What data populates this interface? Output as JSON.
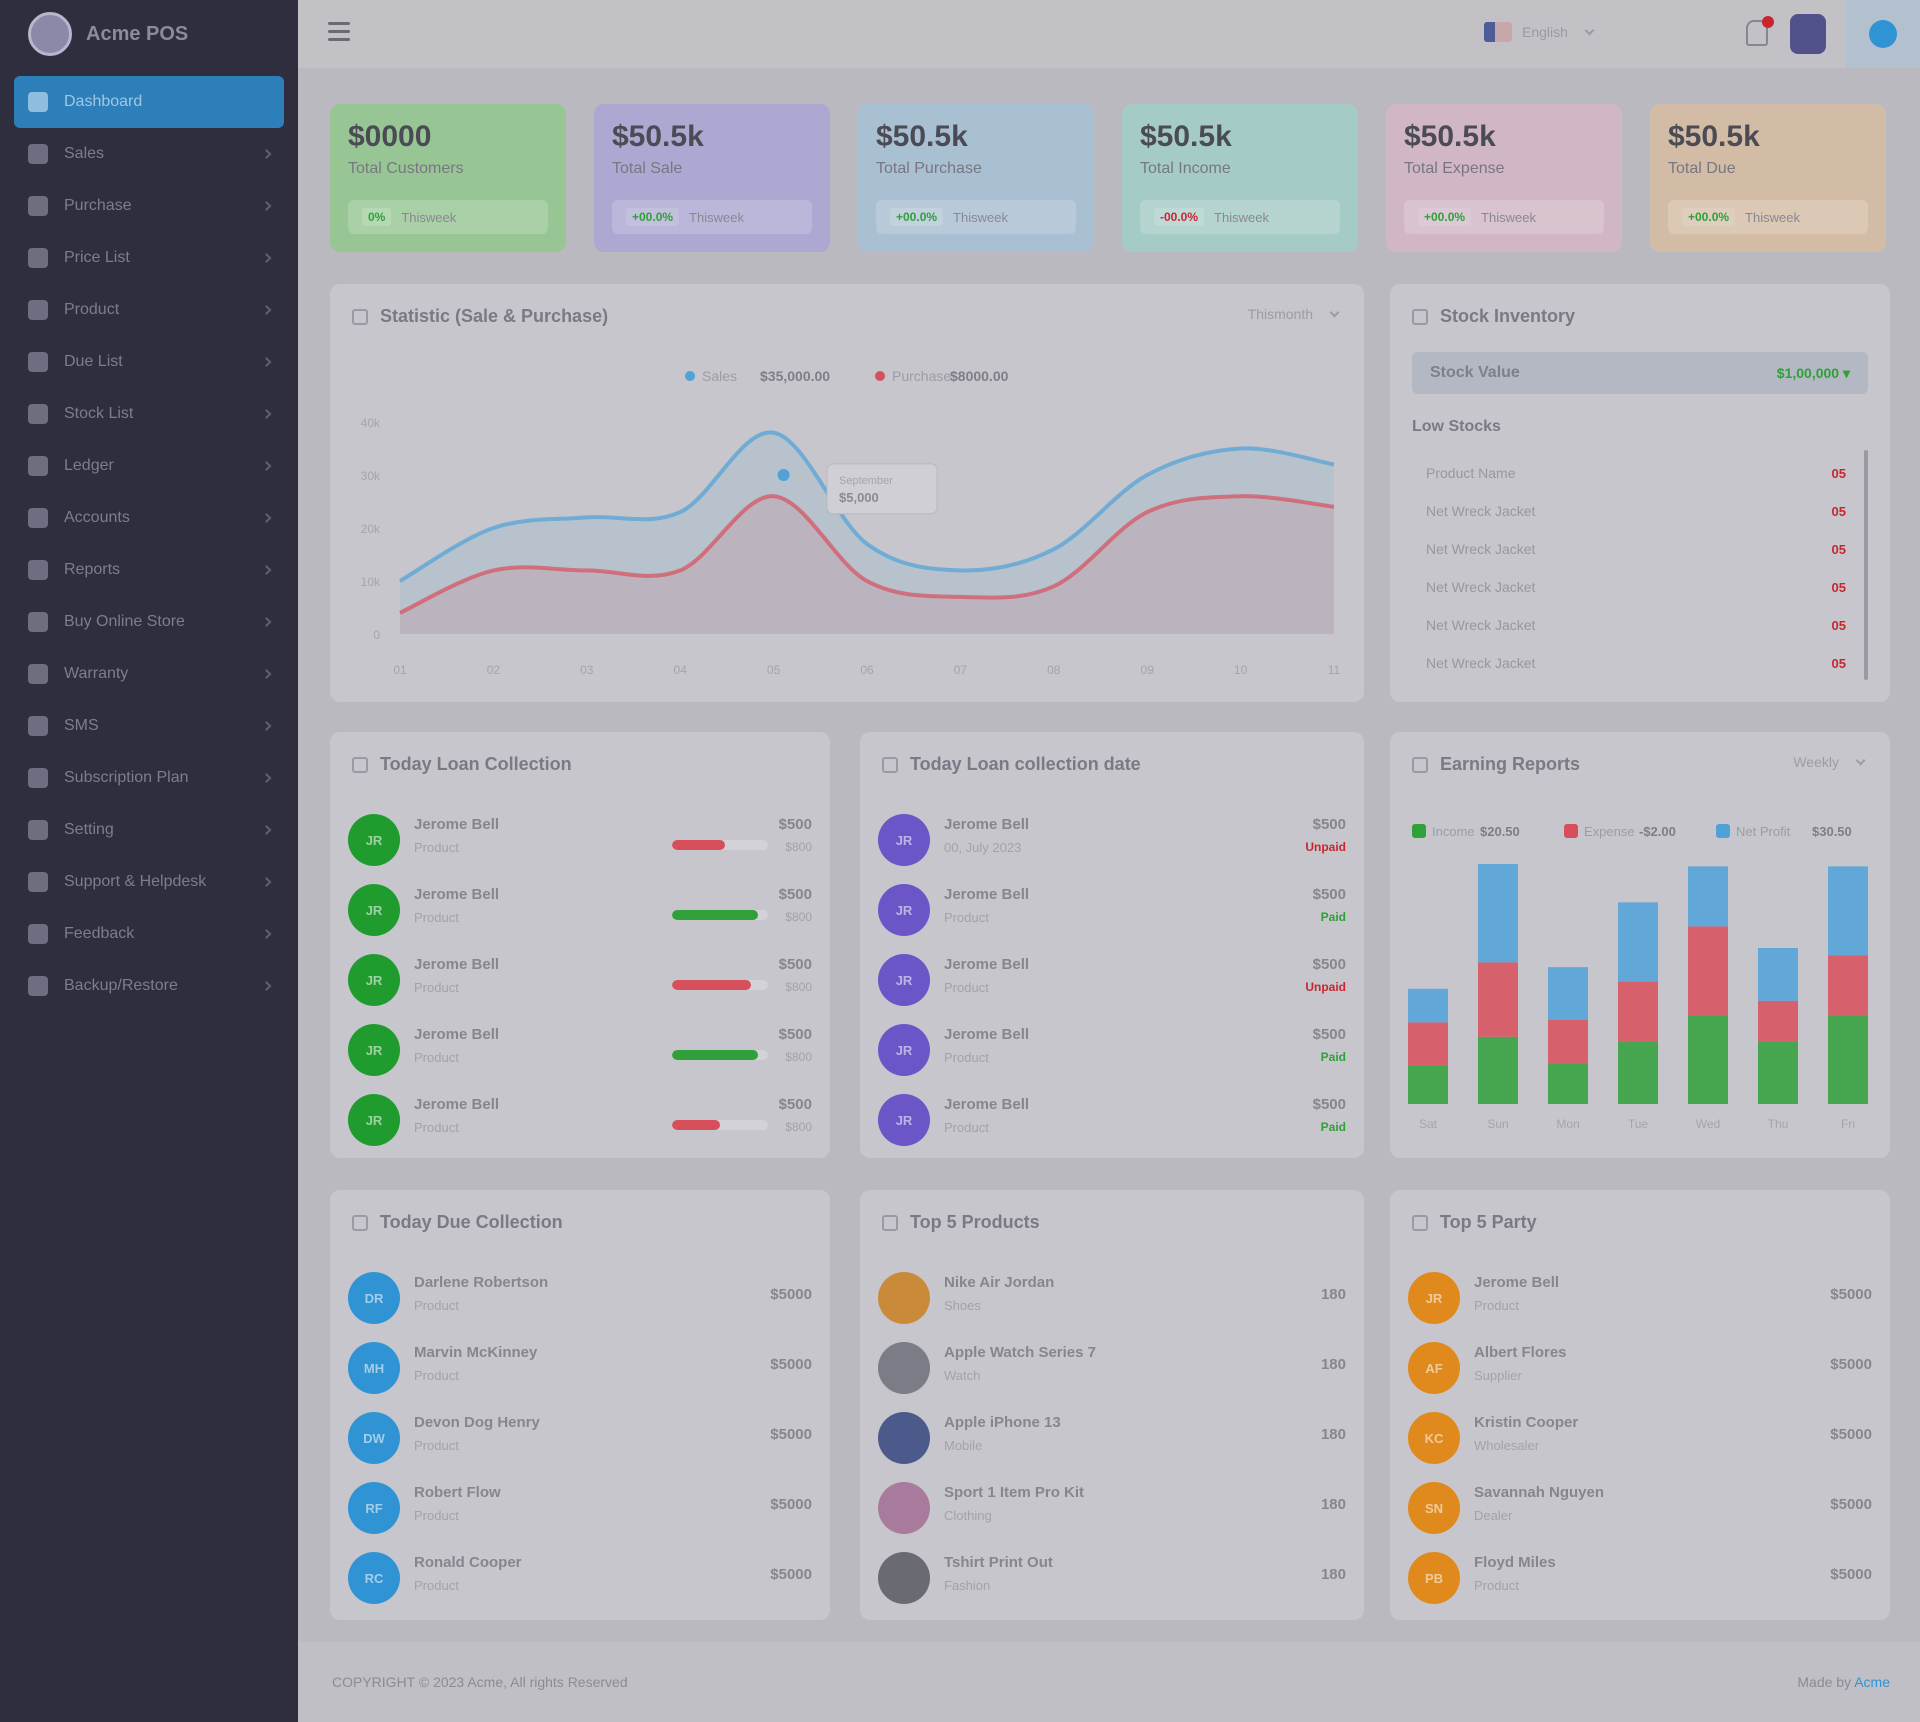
{
  "brand": {
    "name": "Acme POS"
  },
  "sidebar": {
    "items": [
      {
        "label": "Dashboard",
        "active": true
      },
      {
        "label": "Sales"
      },
      {
        "label": "Purchase"
      },
      {
        "label": "Price List"
      },
      {
        "label": "Product"
      },
      {
        "label": "Due List"
      },
      {
        "label": "Stock List"
      },
      {
        "label": "Ledger"
      },
      {
        "label": "Accounts"
      },
      {
        "label": "Reports"
      },
      {
        "label": "Buy Online Store"
      },
      {
        "label": "Warranty"
      },
      {
        "label": "SMS"
      },
      {
        "label": "Subscription Plan"
      },
      {
        "label": "Setting"
      },
      {
        "label": "Support & Helpdesk"
      },
      {
        "label": "Feedback"
      },
      {
        "label": "Backup/Restore"
      }
    ]
  },
  "header": {
    "language": "English"
  },
  "stats": [
    {
      "value": "$0000",
      "label": "Total Customers",
      "chip": "0%",
      "foot": "Thisweek",
      "bg": "#97c694",
      "chipColor": "#2fa03a",
      "chipBg": "#b6d9b4"
    },
    {
      "value": "$50.5k",
      "label": "Total Sale",
      "chip": "+00.0%",
      "foot": "Thisweek",
      "bg": "#ada8d2",
      "chipColor": "#2fa03a",
      "chipBg": "#c3c0de"
    },
    {
      "value": "$50.5k",
      "label": "Total Purchase",
      "chip": "+00.0%",
      "foot": "Thisweek",
      "bg": "#a9bfd2",
      "chipColor": "#2fa03a",
      "chipBg": "#c1d1de"
    },
    {
      "value": "$50.5k",
      "label": "Total Income",
      "chip": "-00.0%",
      "foot": "Thisweek",
      "bg": "#a5cbc6",
      "chipColor": "#c8262f",
      "chipBg": "#bfdad6"
    },
    {
      "value": "$50.5k",
      "label": "Total Expense",
      "chip": "+00.0%",
      "foot": "Thisweek",
      "bg": "#d1b6c5",
      "chipColor": "#2fa03a",
      "chipBg": "#ddc9d5"
    },
    {
      "value": "$50.5k",
      "label": "Total Due",
      "chip": "+00.0%",
      "foot": "Thisweek",
      "bg": "#d3bca5",
      "chipColor": "#2fa03a",
      "chipBg": "#decebe"
    }
  ],
  "statistic": {
    "title": "Statistic (Sale & Purchase)",
    "select": "Thismonth",
    "chart_data": {
      "type": "area",
      "x": [
        "01",
        "02",
        "03",
        "04",
        "05",
        "06",
        "07",
        "08",
        "09",
        "10",
        "11"
      ],
      "yticks": [
        "0",
        "10k",
        "20k",
        "30k",
        "40k"
      ],
      "ylim": [
        0,
        40
      ],
      "series": [
        {
          "name": "Sales",
          "total": "$35,000.00",
          "color": "#4fa1d8",
          "values": [
            10,
            20,
            22,
            23,
            38,
            17,
            12,
            16,
            30,
            35,
            32
          ]
        },
        {
          "name": "Purchase",
          "total": "$8000.00",
          "color": "#d84f5c",
          "values": [
            4,
            12,
            12,
            12,
            26,
            10,
            7,
            9,
            23,
            26,
            24
          ]
        }
      ],
      "tooltip": {
        "label": "September",
        "value": "$5,000"
      }
    }
  },
  "stock": {
    "title": "Stock Inventory",
    "status_label": "Stock Value",
    "status_value": "$1,00,000 ▾",
    "low_title": "Low Stocks",
    "items": [
      {
        "name": "Product Name",
        "qty": "05"
      },
      {
        "name": "Net Wreck Jacket",
        "qty": "05"
      },
      {
        "name": "Net Wreck Jacket",
        "qty": "05"
      },
      {
        "name": "Net Wreck Jacket",
        "qty": "05"
      },
      {
        "name": "Net Wreck Jacket",
        "qty": "05"
      },
      {
        "name": "Net Wreck Jacket",
        "qty": "05"
      }
    ]
  },
  "loan": {
    "title": "Today Loan Collection",
    "rows": [
      {
        "initials": "JR",
        "name": "Jerome Bell",
        "sub": "Product",
        "amount": "$500",
        "total": "$800",
        "pct": 55,
        "color": "#d84f5c"
      },
      {
        "initials": "JR",
        "name": "Jerome Bell",
        "sub": "Product",
        "amount": "$500",
        "total": "$800",
        "pct": 90,
        "color": "#2fa03a"
      },
      {
        "initials": "JR",
        "name": "Jerome Bell",
        "sub": "Product",
        "amount": "$500",
        "total": "$800",
        "pct": 82,
        "color": "#d84f5c"
      },
      {
        "initials": "JR",
        "name": "Jerome Bell",
        "sub": "Product",
        "amount": "$500",
        "total": "$800",
        "pct": 90,
        "color": "#2fa03a"
      },
      {
        "initials": "JR",
        "name": "Jerome Bell",
        "sub": "Product",
        "amount": "$500",
        "total": "$800",
        "pct": 50,
        "color": "#d84f5c"
      }
    ]
  },
  "loan_date": {
    "title": "Today Loan collection date",
    "rows": [
      {
        "initials": "JR",
        "name": "Jerome Bell",
        "sub": "00, July 2023",
        "amount": "$500",
        "status": "Unpaid",
        "color": "#c8262f"
      },
      {
        "initials": "JR",
        "name": "Jerome Bell",
        "sub": "Product",
        "amount": "$500",
        "status": "Paid",
        "color": "#2fa03a"
      },
      {
        "initials": "JR",
        "name": "Jerome Bell",
        "sub": "Product",
        "amount": "$500",
        "status": "Unpaid",
        "color": "#c8262f"
      },
      {
        "initials": "JR",
        "name": "Jerome Bell",
        "sub": "Product",
        "amount": "$500",
        "status": "Paid",
        "color": "#2fa03a"
      },
      {
        "initials": "JR",
        "name": "Jerome Bell",
        "sub": "Product",
        "amount": "$500",
        "status": "Paid",
        "color": "#2fa03a"
      }
    ]
  },
  "earning": {
    "title": "Earning Reports",
    "select": "Weekly",
    "chart_data": {
      "type": "bar",
      "categories": [
        "Sat",
        "Sun",
        "Mon",
        "Tue",
        "Wed",
        "Thu",
        "Fri"
      ],
      "ylim": [
        0,
        100
      ],
      "series": [
        {
          "name": "Income",
          "total": "$20.50",
          "color": "#2fa03a",
          "values": [
            16,
            28,
            17,
            26,
            37,
            26,
            37
          ]
        },
        {
          "name": "Expense",
          "total": "-$2.00",
          "color": "#d84f5c",
          "values": [
            18,
            31,
            18,
            25,
            37,
            17,
            25
          ]
        },
        {
          "name": "Net Profit",
          "total": "$30.50",
          "color": "#4fa1d8",
          "values": [
            14,
            41,
            22,
            33,
            25,
            22,
            37
          ]
        }
      ]
    }
  },
  "due": {
    "title": "Today Due Collection",
    "rows": [
      {
        "initials": "DR",
        "name": "Darlene Robertson",
        "sub": "Product",
        "amount": "$5000"
      },
      {
        "initials": "MH",
        "name": "Marvin McKinney",
        "sub": "Product",
        "amount": "$5000"
      },
      {
        "initials": "DW",
        "name": "Devon Dog Henry",
        "sub": "Product",
        "amount": "$5000"
      },
      {
        "initials": "RF",
        "name": "Robert Flow",
        "sub": "Product",
        "amount": "$5000"
      },
      {
        "initials": "RC",
        "name": "Ronald Cooper",
        "sub": "Product",
        "amount": "$5000"
      }
    ]
  },
  "products": {
    "title": "Top 5 Products",
    "rows": [
      {
        "name": "Nike Air Jordan",
        "sub": "Shoes",
        "amount": "180",
        "color": "#c98a3a"
      },
      {
        "name": "Apple Watch Series 7",
        "sub": "Watch",
        "amount": "180",
        "color": "#7c7c86"
      },
      {
        "name": "Apple iPhone 13",
        "sub": "Mobile",
        "amount": "180",
        "color": "#4b5a8a"
      },
      {
        "name": "Sport 1 Item Pro Kit",
        "sub": "Clothing",
        "amount": "180",
        "color": "#a87b9c"
      },
      {
        "name": "Tshirt Print Out",
        "sub": "Fashion",
        "amount": "180",
        "color": "#6a6a72"
      }
    ]
  },
  "parties": {
    "title": "Top 5 Party",
    "rows": [
      {
        "initials": "JR",
        "name": "Jerome Bell",
        "sub": "Product",
        "amount": "$5000"
      },
      {
        "initials": "AF",
        "name": "Albert Flores",
        "sub": "Supplier",
        "amount": "$5000"
      },
      {
        "initials": "KC",
        "name": "Kristin Cooper",
        "sub": "Wholesaler",
        "amount": "$5000"
      },
      {
        "initials": "SN",
        "name": "Savannah Nguyen",
        "sub": "Dealer",
        "amount": "$5000"
      },
      {
        "initials": "PB",
        "name": "Floyd Miles",
        "sub": "Product",
        "amount": "$5000"
      }
    ]
  },
  "footer": {
    "copyright": "COPYRIGHT © 2023 Acme, All rights Reserved",
    "made_prefix": "Made by ",
    "made_by": "Acme"
  },
  "colors": {
    "accent": "#2c7fb8",
    "loanAvatar": "#1f9c2d",
    "dateAvatar": "#6b55c7",
    "dueAvatar": "#2f93d4",
    "partyAvatar": "#e08a1e"
  }
}
